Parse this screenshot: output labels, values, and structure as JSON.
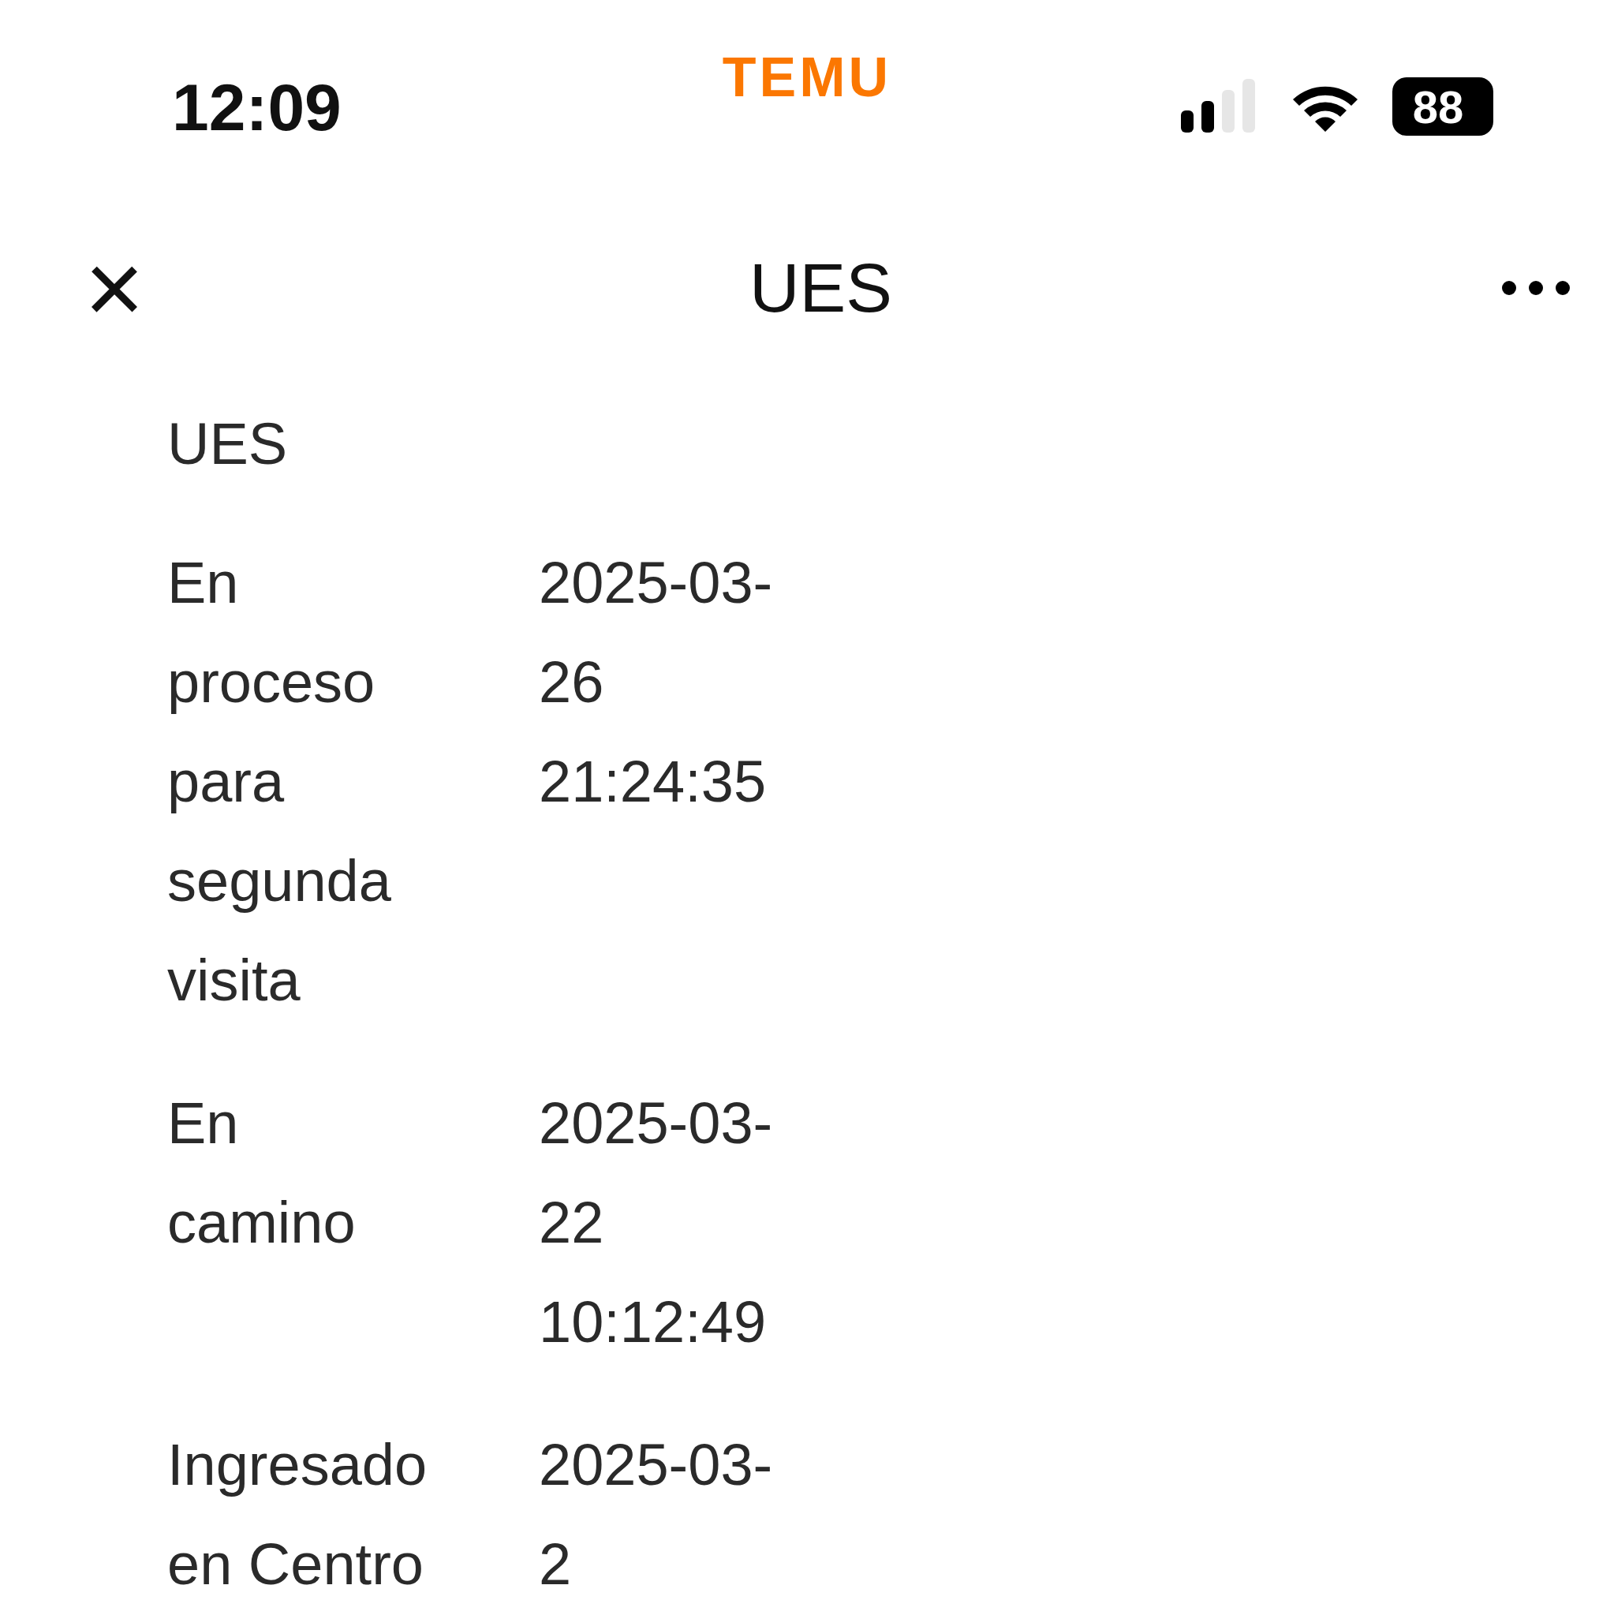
{
  "status_bar": {
    "time": "12:09",
    "app_logo": "TEMU",
    "battery": "88"
  },
  "header": {
    "close": "×",
    "title": "UES"
  },
  "carrier": "UES",
  "events": [
    {
      "status": "En proceso para segunda visita",
      "time": "2025-03-26 21:24:35"
    },
    {
      "status": "En camino",
      "time": "2025-03-22 10:12:49"
    },
    {
      "status": "Ingresado en Centro",
      "time": "2025-03-2"
    }
  ]
}
